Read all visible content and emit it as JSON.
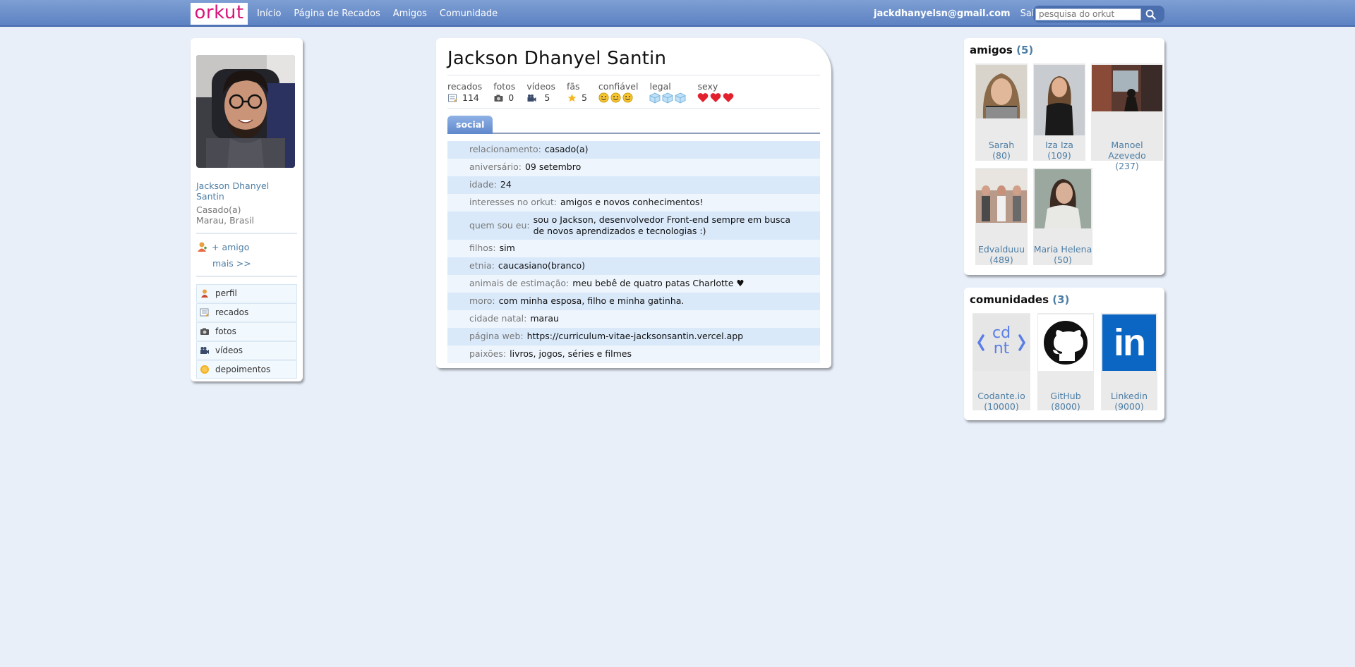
{
  "topbar": {
    "logo": "orkut",
    "nav": [
      "Início",
      "Página de Recados",
      "Amigos",
      "Comunidade"
    ],
    "email": "jackdhanyelsn@gmail.com",
    "logout": "Sair",
    "search_placeholder": "pesquisa do orkut"
  },
  "profile": {
    "name": "Jackson Dhanyel Santin",
    "status": "Casado(a)",
    "location": "Marau, Brasil",
    "add_friend": "+ amigo",
    "more": "mais >>",
    "menu": [
      {
        "label": "perfil",
        "icon": "profile-icon"
      },
      {
        "label": "recados",
        "icon": "scrap-icon"
      },
      {
        "label": "fotos",
        "icon": "camera-icon"
      },
      {
        "label": "vídeos",
        "icon": "video-icon"
      },
      {
        "label": "depoimentos",
        "icon": "testimonial-icon"
      }
    ]
  },
  "main": {
    "title": "Jackson Dhanyel Santin",
    "stats": {
      "recados": {
        "label": "recados",
        "value": "114"
      },
      "fotos": {
        "label": "fotos",
        "value": "0"
      },
      "videos": {
        "label": "vídeos",
        "value": "5"
      },
      "fas": {
        "label": "fãs",
        "value": "5"
      },
      "confiavel": {
        "label": "confiável",
        "level": 3
      },
      "legal": {
        "label": "legal",
        "level": 3
      },
      "sexy": {
        "label": "sexy",
        "level": 3
      }
    },
    "tab": "social",
    "rows": [
      {
        "k": "relacionamento:",
        "v": "casado(a)"
      },
      {
        "k": "aniversário:",
        "v": "09 setembro"
      },
      {
        "k": "idade:",
        "v": "24"
      },
      {
        "k": "interesses no orkut:",
        "v": "amigos e novos conhecimentos!"
      },
      {
        "k": "quem sou eu:",
        "v": "sou o Jackson, desenvolvedor Front-end sempre em busca de novos aprendizados e tecnologias :)"
      },
      {
        "k": "filhos:",
        "v": "sim"
      },
      {
        "k": "etnia:",
        "v": "caucasiano(branco)"
      },
      {
        "k": "animais de estimação:",
        "v": "meu bebê de quatro patas Charlotte ♥"
      },
      {
        "k": "moro:",
        "v": "com minha esposa, filho e minha gatinha."
      },
      {
        "k": "cidade natal:",
        "v": "marau"
      },
      {
        "k": "página web:",
        "v": "https://curriculum-vitae-jacksonsantin.vercel.app"
      },
      {
        "k": "paixões:",
        "v": "livros, jogos, séries e filmes"
      }
    ]
  },
  "friends": {
    "title": "amigos",
    "count": "(5)",
    "items": [
      {
        "name": "Sarah",
        "count": "(80)"
      },
      {
        "name": "Iza Iza",
        "count": "(109)"
      },
      {
        "name": "Manoel Azevedo",
        "count": "(237)"
      },
      {
        "name": "Edvalduuu",
        "count": "(489)"
      },
      {
        "name": "Maria Helena",
        "count": "(50)"
      }
    ]
  },
  "communities": {
    "title": "comunidades",
    "count": "(3)",
    "items": [
      {
        "name": "Codante.io",
        "count": "(10000)",
        "logo_text": "cd nt"
      },
      {
        "name": "GitHub",
        "count": "(8000)"
      },
      {
        "name": "Linkedin",
        "count": "(9000)",
        "logo_text": "in"
      }
    ]
  },
  "colors": {
    "accent": "#4d7ea5",
    "topbar": "#5d82c2",
    "row_alt": "#d9e9fa",
    "linkedin": "#0a66c2"
  }
}
